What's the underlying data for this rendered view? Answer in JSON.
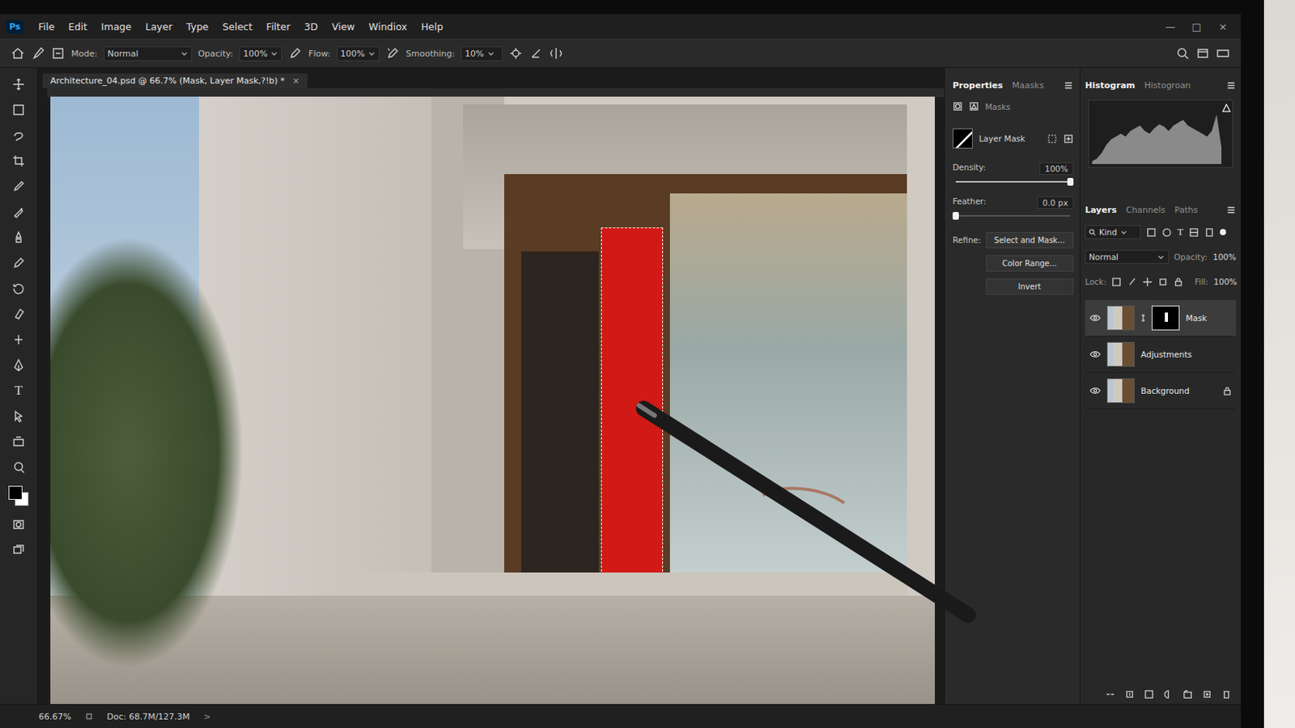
{
  "app": {
    "logo": "Ps"
  },
  "menu": [
    "File",
    "Edit",
    "Image",
    "Layer",
    "Type",
    "Select",
    "Filter",
    "3D",
    "View",
    "Windiox",
    "Help"
  ],
  "window_controls": [
    "—",
    "□",
    "×"
  ],
  "options_bar": {
    "mode_label": "Mode:",
    "mode": "Normal",
    "opacity_label": "Opacity:",
    "opacity": "100%",
    "flow_label": "Flow:",
    "flow": "100%",
    "smoothing_label": "Smoothing:",
    "smoothing": "10%"
  },
  "document_tab": {
    "title": "Architecture_04.psd @ 66.7% (Mask, Layer Mask,?!b) *",
    "close": "×",
    "selected": true
  },
  "toolbar": {
    "tools": [
      {
        "kind": "icon"
      },
      {
        "kind": "icon"
      },
      {
        "kind": "icon"
      },
      {
        "kind": "icon"
      },
      {
        "kind": "icon"
      },
      {
        "kind": "icon"
      },
      {
        "kind": "icon"
      },
      {
        "kind": "icon"
      },
      {
        "kind": "icon"
      },
      {
        "kind": "icon"
      },
      {
        "kind": "icon"
      },
      {
        "kind": "icon"
      },
      {
        "kind": "glyph",
        "glyph": "T"
      },
      {
        "kind": "icon"
      },
      {
        "kind": "icon"
      },
      {
        "kind": "icon"
      }
    ]
  },
  "properties": {
    "tabs": [
      {
        "label": "Properties",
        "selected": true
      },
      {
        "label": "Maasks",
        "selected": false
      }
    ],
    "section": "Masks",
    "mask_label": "Layer Mask",
    "density": {
      "label": "Density:",
      "value": "100%",
      "level": 1.0
    },
    "feather": {
      "label": "Feather:",
      "value": "0.0 px",
      "level": 0.0
    },
    "refine_label": "Refine:",
    "buttons": [
      "Select and Mask...",
      "Color Range...",
      "Invert"
    ]
  },
  "histogram": {
    "tabs": [
      {
        "label": "Histogram",
        "selected": true
      },
      {
        "label": "Histogroan",
        "selected": false
      }
    ],
    "values": [
      0.05,
      0.1,
      0.2,
      0.35,
      0.45,
      0.5,
      0.55,
      0.5,
      0.6,
      0.65,
      0.7,
      0.6,
      0.55,
      0.65,
      0.72,
      0.68,
      0.6,
      0.7,
      0.75,
      0.8,
      0.7,
      0.65,
      0.6,
      0.55,
      0.5,
      0.6,
      0.9,
      0.3
    ]
  },
  "layers": {
    "tabs": [
      {
        "label": "Layers",
        "selected": true
      },
      {
        "label": "Channels",
        "selected": false
      },
      {
        "label": "Paths",
        "selected": false
      }
    ],
    "filter": "Kind",
    "filter_glyph": "T",
    "blend_mode": "Normal",
    "opacity_label": "Opacity:",
    "opacity": "100%",
    "lock_label": "Lock:",
    "fill_label": "Fill:",
    "fill": "100%",
    "items": [
      {
        "name": "Mask",
        "visible": true,
        "selected": true,
        "locked": false,
        "has_mask": true
      },
      {
        "name": "Adjustments",
        "visible": true,
        "selected": false,
        "locked": false,
        "has_mask": false
      },
      {
        "name": "Background",
        "visible": true,
        "selected": false,
        "locked": true,
        "has_mask": false
      }
    ]
  },
  "status_bar": {
    "zoom": "66.67%",
    "doc": "Doc: 68.7M/127.3M",
    "arrow": ">"
  }
}
